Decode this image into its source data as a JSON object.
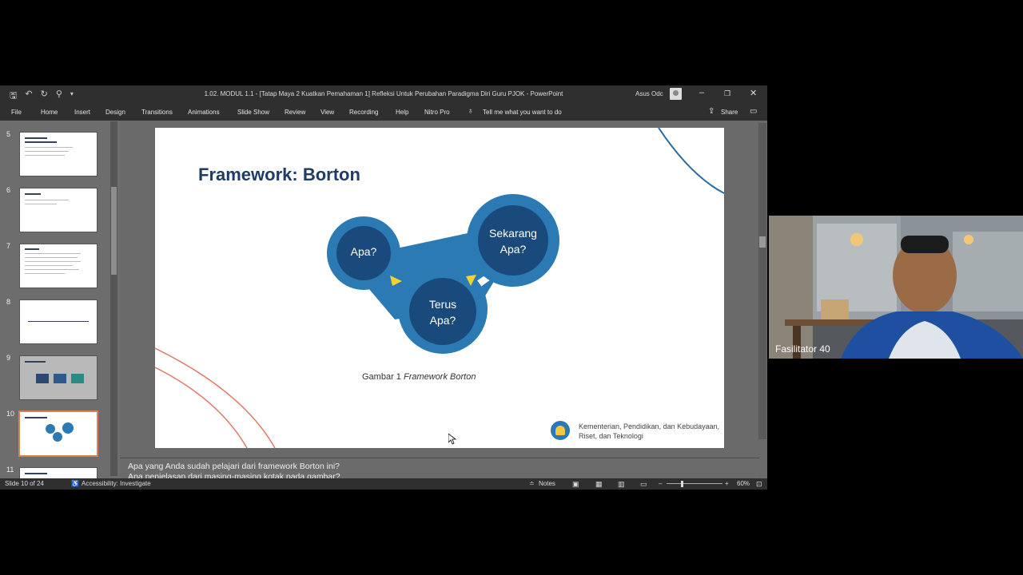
{
  "window": {
    "title": "1.02. MODUL 1.1 - [Tatap Maya 2 Kuatkan Pemahaman 1] Refleksi Untuk Perubahan Paradigma Diri Guru PJOK  -  PowerPoint",
    "user": "Asus Odc",
    "qat_icons": [
      "save-icon",
      "undo-icon",
      "redo-icon",
      "present-icon",
      "customize-icon"
    ]
  },
  "menu": {
    "items": [
      "File",
      "Home",
      "Insert",
      "Design",
      "Transitions",
      "Animations",
      "Slide Show",
      "Review",
      "View",
      "Recording",
      "Help",
      "Nitro Pro"
    ],
    "tell_me": "Tell me what you want to do",
    "share": "Share"
  },
  "thumbnails": {
    "numbers": [
      "5",
      "6",
      "7",
      "8",
      "9",
      "10",
      "11"
    ],
    "selected": "10"
  },
  "slide": {
    "title": "Framework: Borton",
    "circles": [
      "Apa?",
      "Terus\nApa?",
      "Sekarang\nApa?"
    ],
    "caption_plain": "Gambar 1 ",
    "caption_italic": "Framework Borton",
    "footer": "Kementerian, Pendidikan, dan Kebudayaan, Riset, dan Teknologi",
    "colors": {
      "title": "#1f3c64",
      "circle_outer": "#2b7ab3",
      "circle_inner": "#1a4a7c",
      "arrow": "#f5d22f"
    }
  },
  "notes": {
    "line1": "Apa yang Anda sudah pelajari dari framework Borton ini?",
    "line2": "Apa penjelasan dari masing-masing kotak pada gambar?"
  },
  "status": {
    "slide_info": "Slide 10 of 24",
    "accessibility": "Accessibility: Investigate",
    "notes_btn": "Notes",
    "zoom": "60%"
  },
  "video": {
    "participant": "Fasilitator 40"
  }
}
